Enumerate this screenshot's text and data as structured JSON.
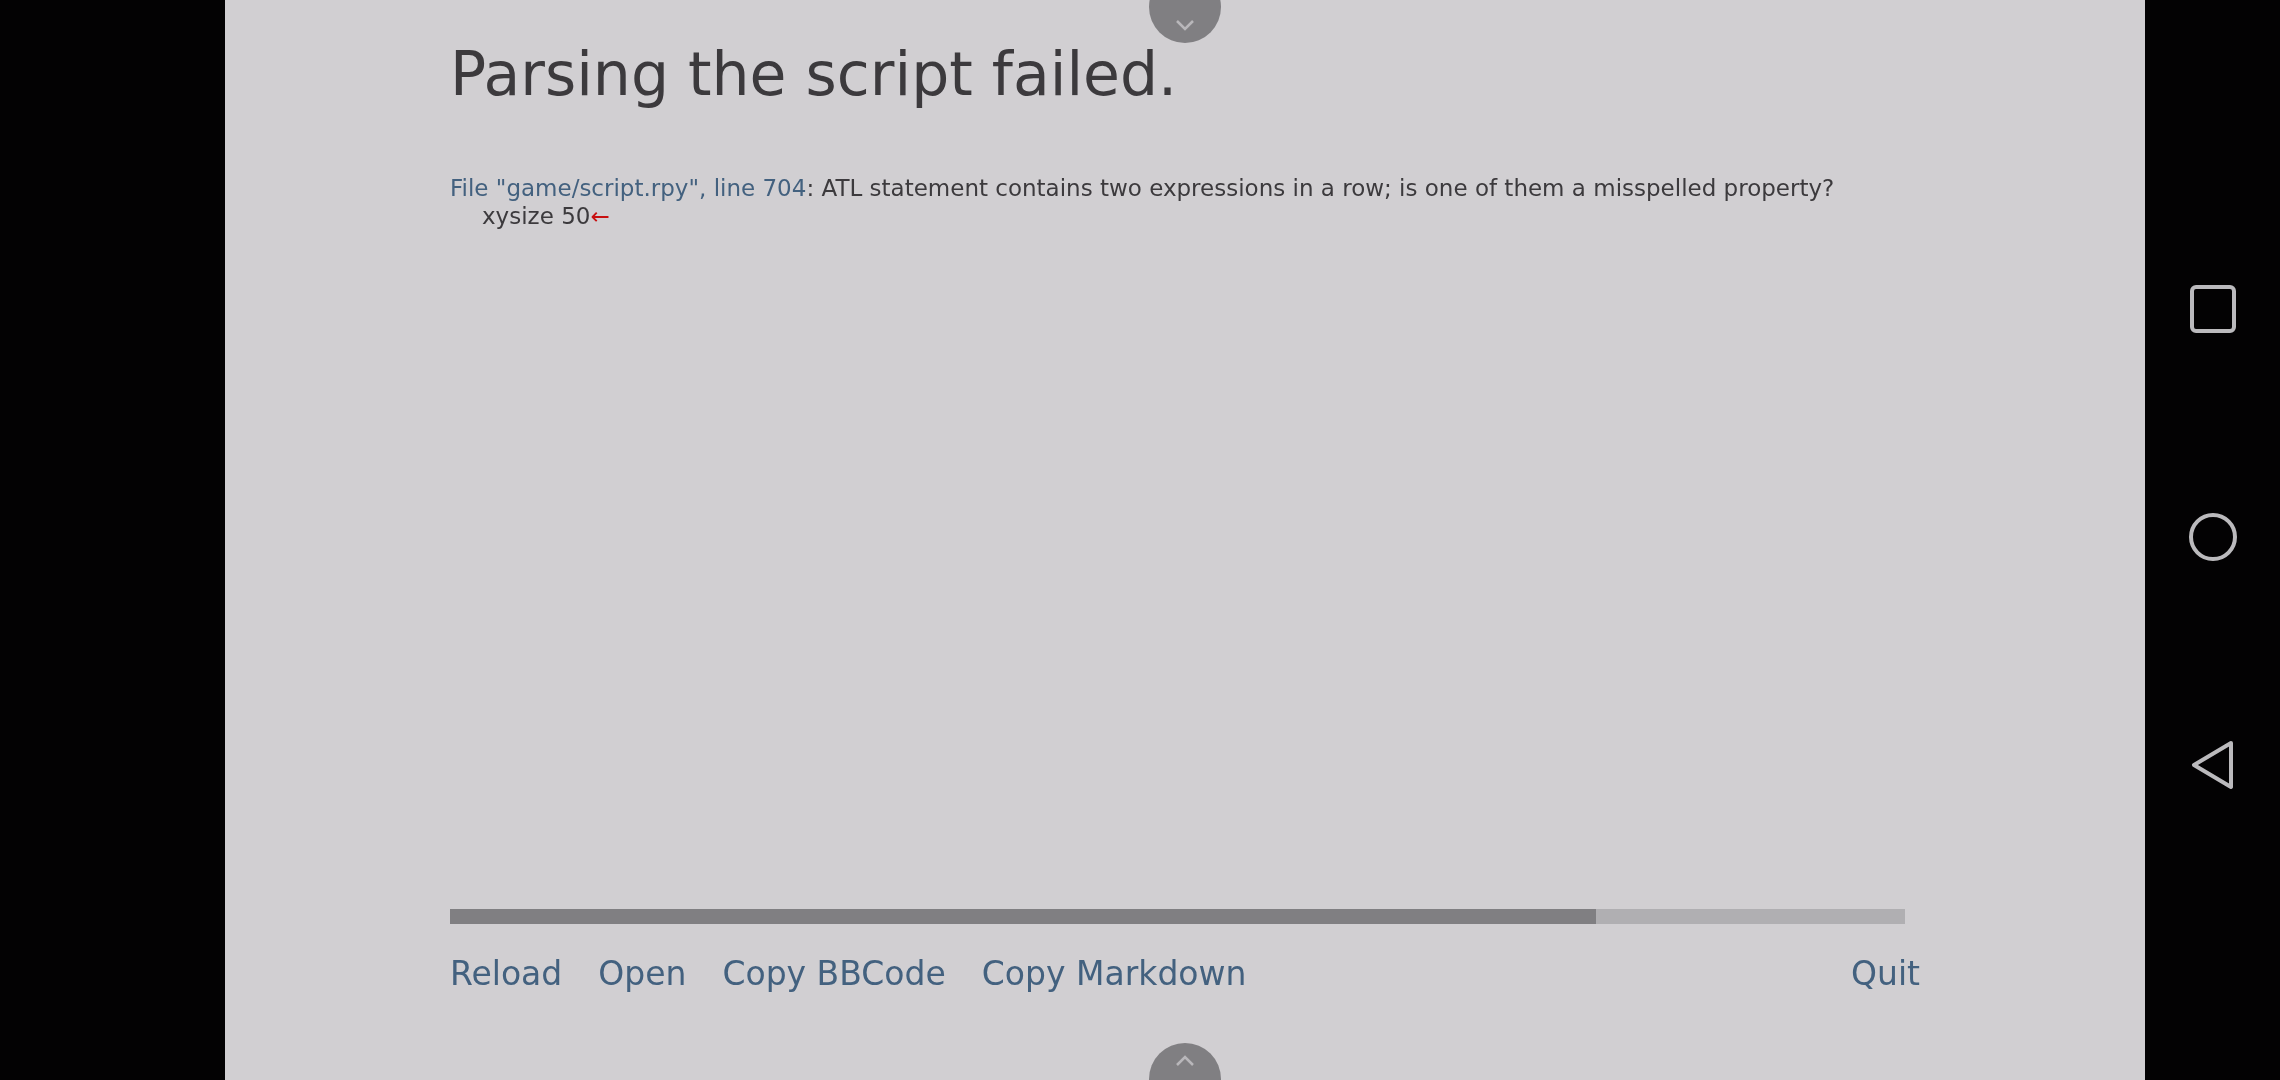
{
  "title": "Parsing the script failed.",
  "error": {
    "location": "File \"game/script.rpy\", line 704",
    "message": ": ATL statement contains two expressions in a row; is one of them a misspelled property?",
    "code_line": "xysize 50",
    "marker": "←"
  },
  "actions": [
    {
      "label": "Reload"
    },
    {
      "label": "Open"
    },
    {
      "label": "Copy BBCode"
    },
    {
      "label": "Copy Markdown"
    }
  ],
  "quit": {
    "label": "Quit"
  }
}
